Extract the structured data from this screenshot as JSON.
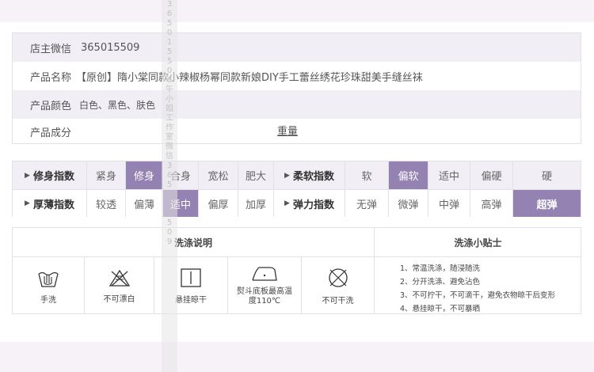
{
  "info": {
    "wechat_label": "店主微信",
    "wechat_value": "365015509",
    "name_label": "产品名称",
    "name_value": "【原创】隋小棠同款小辣椒杨幂同款新娘DIY手工蕾丝绣花珍珠甜美手缝丝袜",
    "color_label": "产品颜色",
    "color_value": "白色、黑色、肤色",
    "composition_label": "产品成分",
    "weight_label": "重量"
  },
  "index": {
    "row1": {
      "fit_label": "修身指数",
      "fit_options": [
        "紧身",
        "修身",
        "合身",
        "宽松",
        "肥大"
      ],
      "fit_selected": "修身",
      "soft_label": "柔软指数",
      "soft_options": [
        "软",
        "偏软",
        "适中",
        "偏硬",
        "硬"
      ],
      "soft_selected": "偏软"
    },
    "row2": {
      "thick_label": "厚薄指数",
      "thick_options": [
        "较透",
        "偏薄",
        "适中",
        "偏厚",
        "加厚"
      ],
      "thick_selected": "适中",
      "elastic_label": "弹力指数",
      "elastic_options": [
        "无弹",
        "微弹",
        "中弹",
        "高弹",
        "超弹"
      ],
      "elastic_selected": "超弹"
    },
    "selected_color": "#9482b3"
  },
  "wash": {
    "instructions_title": "洗涤说明",
    "tips_title": "洗涤小贴士",
    "symbols": [
      {
        "label": "手洗",
        "icon": "hand-wash-icon"
      },
      {
        "label": "不可漂白",
        "icon": "no-bleach-icon"
      },
      {
        "label": "悬挂晾干",
        "icon": "hang-dry-icon"
      },
      {
        "label": "熨斗底板最高温度110℃",
        "icon": "iron-icon"
      },
      {
        "label": "不可干洗",
        "icon": "no-dry-clean-icon"
      }
    ],
    "tips": [
      "1、常温洗涤，随浸随洗",
      "2、分开洗涤、避免沾色",
      "3、不可拧干，不可滴干，避免衣物晾干后变形",
      "4、悬挂晾干，不可暴晒"
    ]
  },
  "watermark": "365015509 午小姐工作室 微信 365015509"
}
